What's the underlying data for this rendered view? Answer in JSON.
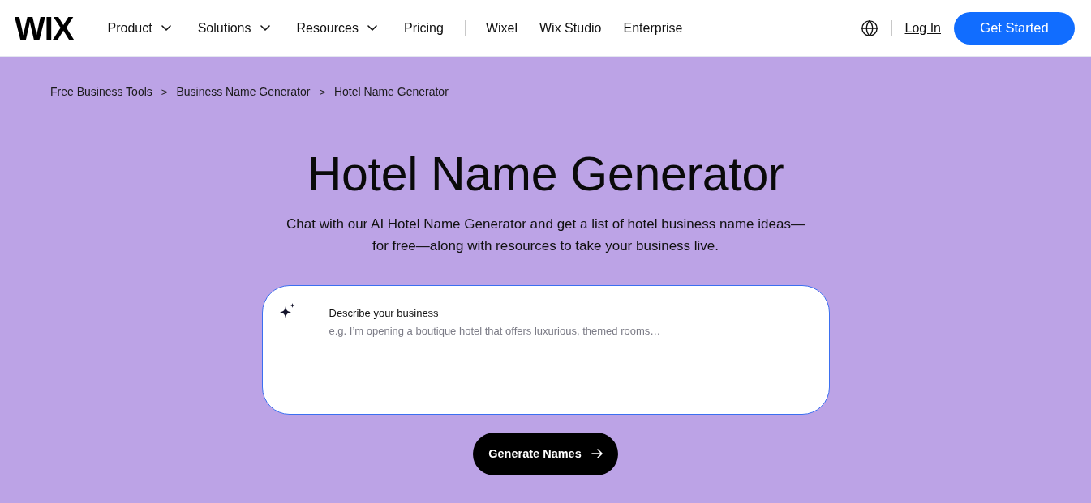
{
  "header": {
    "logo": "WIX",
    "nav": [
      {
        "label": "Product",
        "dropdown": true
      },
      {
        "label": "Solutions",
        "dropdown": true
      },
      {
        "label": "Resources",
        "dropdown": true
      },
      {
        "label": "Pricing",
        "dropdown": false
      }
    ],
    "nav_secondary": [
      "Wixel",
      "Wix Studio",
      "Enterprise"
    ],
    "login": "Log In",
    "cta": "Get Started"
  },
  "breadcrumb": [
    {
      "label": "Free Business Tools"
    },
    {
      "label": "Business Name Generator"
    },
    {
      "label": "Hotel Name Generator"
    }
  ],
  "breadcrumb_separator": ">",
  "hero": {
    "title": "Hotel Name Generator",
    "subtitle": "Chat with our AI Hotel Name Generator and get a list of hotel business name ideas—for free—along with resources to take your business live."
  },
  "prompt": {
    "label": "Describe your business",
    "placeholder": "e.g. I’m opening a boutique hotel that offers luxurious, themed rooms…"
  },
  "generate_button": "Generate Names"
}
